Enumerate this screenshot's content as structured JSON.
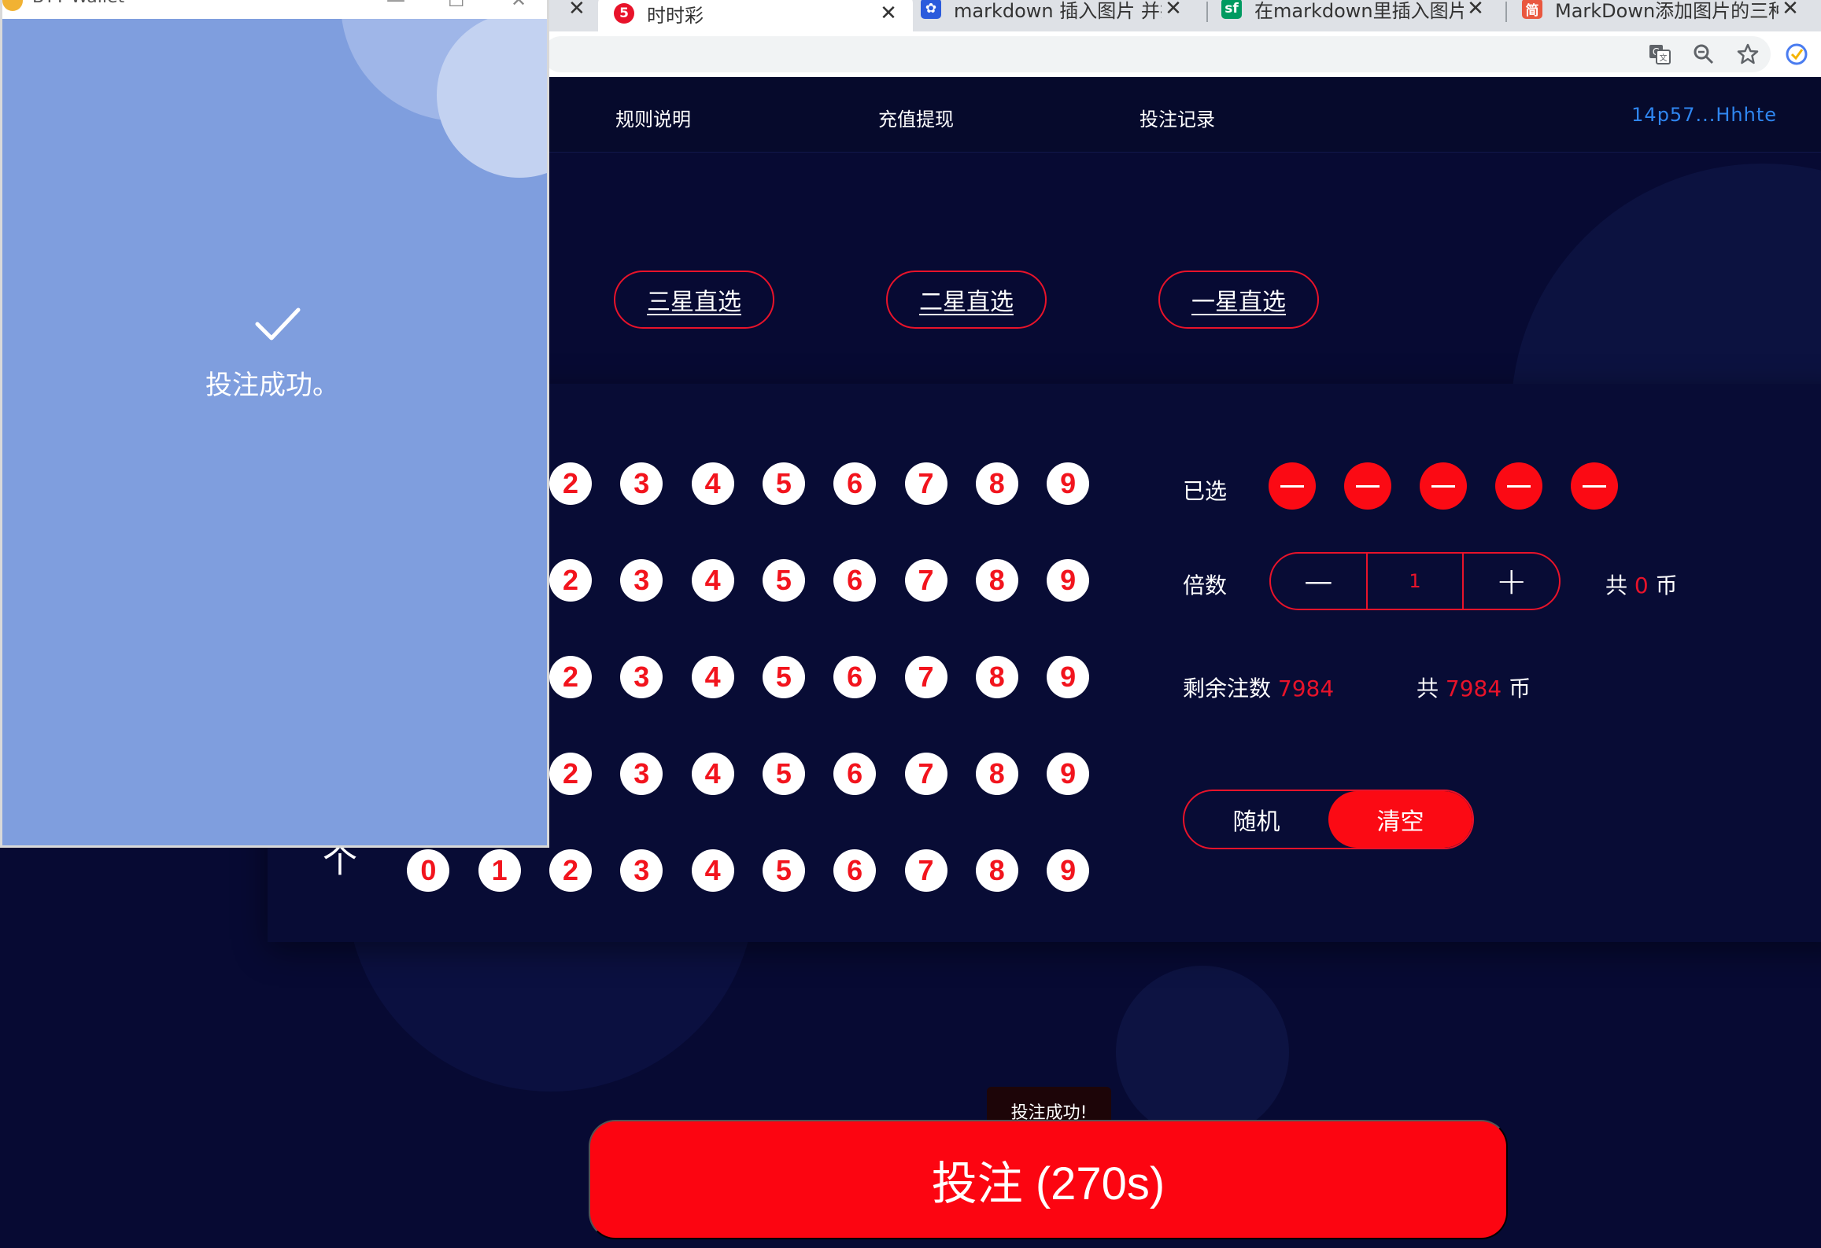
{
  "browser": {
    "tabs": [
      {
        "title": "时时彩",
        "icon": "number-5-favicon-icon",
        "color": "#e8132a",
        "active": true
      },
      {
        "title": "markdown 插入图片 并排列",
        "icon": "paw-favicon-icon",
        "color": "#2b5bdc"
      },
      {
        "title": "在markdown里插入图片 - 风",
        "icon": "sf-favicon-icon",
        "color": "#009a61",
        "glyph": "sf"
      },
      {
        "title": "MarkDown添加图片的三种方",
        "icon": "jian-favicon-icon",
        "color": "#e9573f",
        "glyph": "简"
      }
    ],
    "close_glyph": "✕"
  },
  "nav": {
    "items": [
      "规则说明",
      "充值提现",
      "投注记录"
    ],
    "wallet_address": "14p57...Hhhte"
  },
  "modes": [
    "三星直选",
    "二星直选",
    "一星直选"
  ],
  "number_grid": {
    "visible_digits": [
      "2",
      "3",
      "4",
      "5",
      "6",
      "7",
      "8",
      "9"
    ],
    "last_row_digits": [
      "0",
      "1",
      "2",
      "3",
      "4",
      "5",
      "6",
      "7",
      "8",
      "9"
    ],
    "row_arrow": "个"
  },
  "selection": {
    "selected_label": "已选",
    "selected_slots": 5,
    "multiplier_label": "倍数",
    "multiplier_value": "1",
    "minus": "—",
    "plus": "+",
    "total_prefix": "共",
    "total_value": "0",
    "total_suffix": "币",
    "remaining_label": "剩余注数",
    "remaining_value": "7984",
    "remaining_total_prefix": "共",
    "remaining_total_value": "7984",
    "remaining_total_suffix": "币",
    "random_label": "随机",
    "clear_label": "清空"
  },
  "bet": {
    "button_label": "投注 (270s)",
    "toast": "投注成功!"
  },
  "wallet_window": {
    "title": "BTY Wallet",
    "message": "投注成功。"
  },
  "colors": {
    "accent_red": "#fb0a14",
    "background": "#070a33",
    "wallet_blue": "#7f9ede",
    "link_blue": "#2f86f0"
  }
}
